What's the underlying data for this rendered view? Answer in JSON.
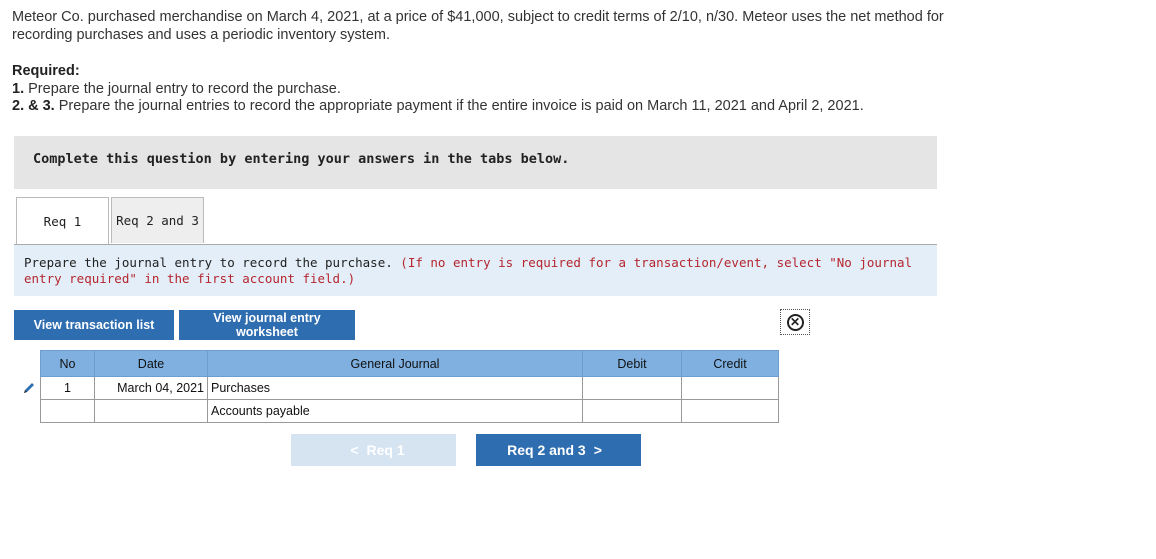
{
  "problem": {
    "intro": "Meteor Co. purchased merchandise on March 4, 2021, at a price of $41,000, subject to credit terms of 2/10, n/30. Meteor uses the net method for recording purchases and uses a periodic inventory system.",
    "required_label": "Required:",
    "req1_num": "1.",
    "req1_text": "Prepare the journal entry to record the purchase.",
    "req23_num": "2. & 3.",
    "req23_text": "Prepare the journal entries to record the appropriate payment if the entire invoice is paid on March 11, 2021 and April 2, 2021."
  },
  "instruction": "Complete this question by entering your answers in the tabs below.",
  "tabs": [
    {
      "label": "Req 1",
      "active": true
    },
    {
      "label": "Req 2 and 3",
      "active": false
    }
  ],
  "prompt": {
    "main": "Prepare the journal entry to record the purchase.",
    "note": "(If no entry is required for a transaction/event, select \"No journal entry required\" in the first account field.)"
  },
  "buttons": {
    "view_transaction_list": "View transaction list",
    "view_journal_worksheet": "View journal entry worksheet"
  },
  "journal": {
    "headers": {
      "no": "No",
      "date": "Date",
      "general_journal": "General Journal",
      "debit": "Debit",
      "credit": "Credit"
    },
    "rows": [
      {
        "no": "1",
        "date": "March 04, 2021",
        "account": "Purchases",
        "debit": "",
        "credit": ""
      },
      {
        "no": "",
        "date": "",
        "account": "Accounts payable",
        "debit": "",
        "credit": ""
      }
    ]
  },
  "nav": {
    "prev_label": "Req 1",
    "next_label": "Req 2 and 3"
  },
  "colors": {
    "accent": "#2e6db0",
    "table_header": "#7fb0e0",
    "prompt_bg": "#e3eef8",
    "note_red": "#b5262e"
  },
  "icons": [
    "close-icon",
    "pencil-icon",
    "chevron-left-icon",
    "chevron-right-icon"
  ]
}
